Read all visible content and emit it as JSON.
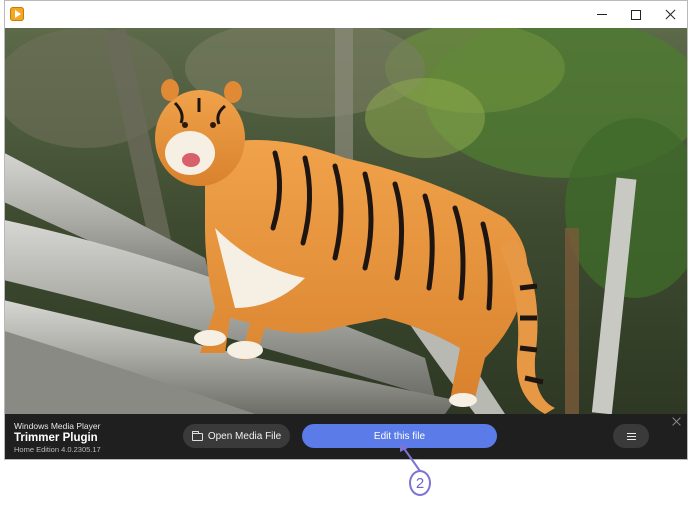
{
  "window": {
    "icon": "media-player-app-icon"
  },
  "controls": {
    "brand_subtitle": "Windows Media Player",
    "brand_title": "Trimmer Plugin",
    "brand_version": "Home Edition 4.0.2305.17",
    "open_label": "Open Media File",
    "edit_label": "Edit this file",
    "menu_icon": "hamburger-icon",
    "accent_color": "#5b7ce8"
  },
  "callout": {
    "number": "2",
    "color": "#7b73d6"
  }
}
